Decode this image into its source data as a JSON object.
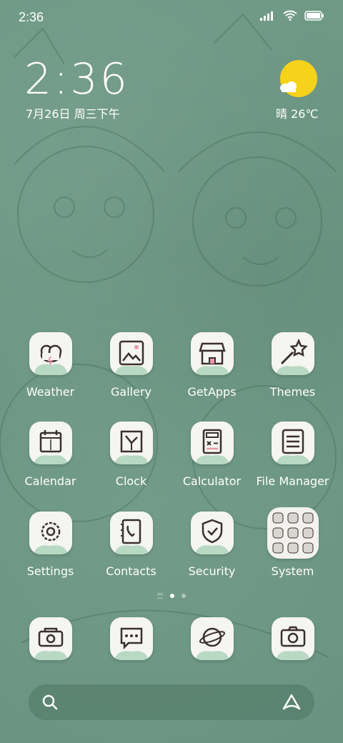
{
  "status_bar": {
    "time": "2:36"
  },
  "clock_widget": {
    "time": "2:36",
    "date": "7月26日 周三下午"
  },
  "weather_widget": {
    "text": "晴 26℃",
    "sun_color": "#f7d21a"
  },
  "apps": [
    {
      "label": "Weather",
      "icon": "weather-icon"
    },
    {
      "label": "Gallery",
      "icon": "gallery-icon"
    },
    {
      "label": "GetApps",
      "icon": "getapps-icon"
    },
    {
      "label": "Themes",
      "icon": "themes-icon"
    },
    {
      "label": "Calendar",
      "icon": "calendar-icon"
    },
    {
      "label": "Clock",
      "icon": "clock-icon"
    },
    {
      "label": "Calculator",
      "icon": "calculator-icon"
    },
    {
      "label": "File Manager",
      "icon": "file-manager-icon"
    },
    {
      "label": "Settings",
      "icon": "settings-icon"
    },
    {
      "label": "Contacts",
      "icon": "contacts-icon"
    },
    {
      "label": "Security",
      "icon": "security-icon"
    },
    {
      "label": "System",
      "icon": "system-folder-icon"
    }
  ],
  "dock": [
    {
      "icon": "phone-icon"
    },
    {
      "icon": "messages-icon"
    },
    {
      "icon": "browser-icon"
    },
    {
      "icon": "camera-icon"
    }
  ],
  "page_indicator": {
    "pages": 2,
    "current": 1
  },
  "search_bar": {
    "left_icon": "search-icon",
    "right_icon": "app-vault-icon"
  },
  "colors": {
    "wallpaper": "#6f9a86",
    "icon_bg": "#f5f5f2",
    "icon_line": "#3a2f2f",
    "accent_pink": "#e59aa6",
    "accent_green": "#8fc7a4"
  }
}
